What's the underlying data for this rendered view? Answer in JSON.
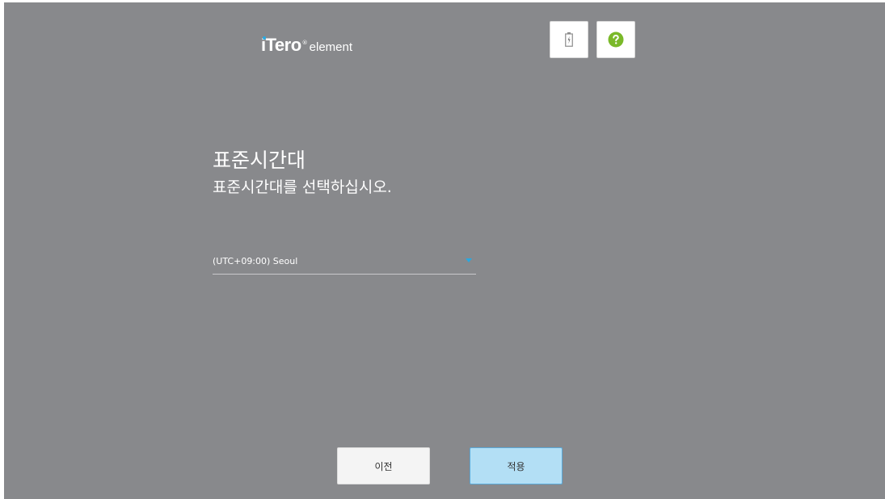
{
  "header": {
    "logo": {
      "brand": "iTero",
      "registered_mark": "®",
      "product": "element"
    },
    "toolbar": {
      "battery_icon": "battery-charging-icon",
      "help_icon": "help-icon"
    }
  },
  "main": {
    "title": "표준시간대",
    "subtitle": "표준시간대를 선택하십시오.",
    "timezone_select": {
      "selected_value": "(UTC+09:00) Seoul"
    }
  },
  "footer": {
    "prev_label": "이전",
    "apply_label": "적용"
  },
  "colors": {
    "background": "#88898c",
    "accent": "#29a8e0",
    "apply_button": "#b3dff5",
    "help_green": "#7ab929"
  }
}
